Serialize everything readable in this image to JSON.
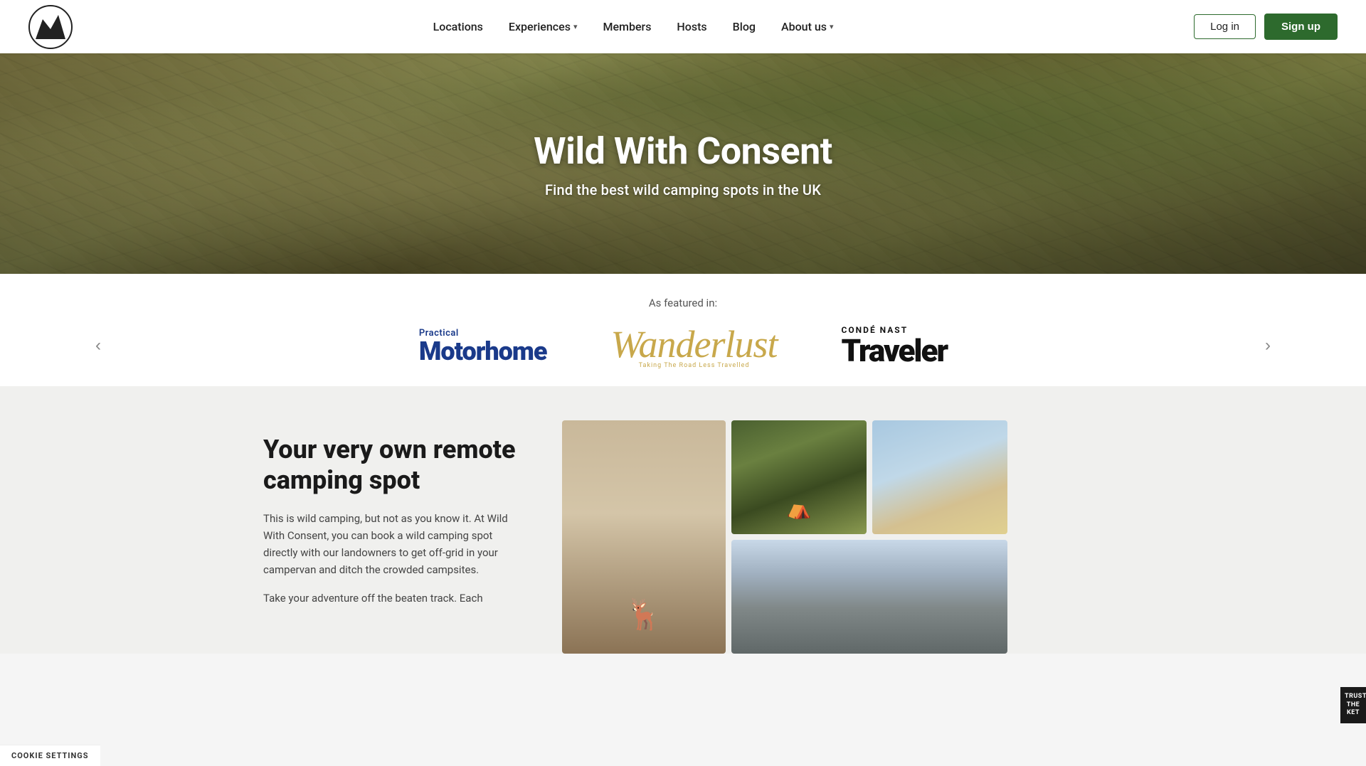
{
  "navbar": {
    "logo_alt": "Wild With Consent Logo",
    "nav_items": [
      {
        "label": "Locations",
        "has_dropdown": false
      },
      {
        "label": "Experiences",
        "has_dropdown": true
      },
      {
        "label": "Members",
        "has_dropdown": false
      },
      {
        "label": "Hosts",
        "has_dropdown": false
      },
      {
        "label": "Blog",
        "has_dropdown": false
      },
      {
        "label": "About us",
        "has_dropdown": true
      }
    ],
    "login_label": "Log in",
    "signup_label": "Sign up"
  },
  "hero": {
    "title": "Wild With Consent",
    "subtitle": "Find the best wild camping spots in the UK"
  },
  "featured": {
    "label": "As featured in:",
    "logos": [
      {
        "name": "Practical Motorhome",
        "type": "practical-motorhome"
      },
      {
        "name": "Wanderlust",
        "type": "wanderlust"
      },
      {
        "name": "Condé Nast Traveler",
        "type": "conde-nast-traveler"
      }
    ]
  },
  "main_section": {
    "heading": "Your very own remote camping spot",
    "body1": "This is wild camping, but not as you know it. At Wild With Consent, you can book a wild camping spot directly with our landowners to get off-grid in your campervan and ditch the crowded campsites.",
    "body2": "Take your adventure off the beaten track. Each"
  },
  "cookie": {
    "label": "Cookie Settings"
  },
  "trust": {
    "line1": "TRUST",
    "line2": "THE",
    "line3": "KET"
  }
}
